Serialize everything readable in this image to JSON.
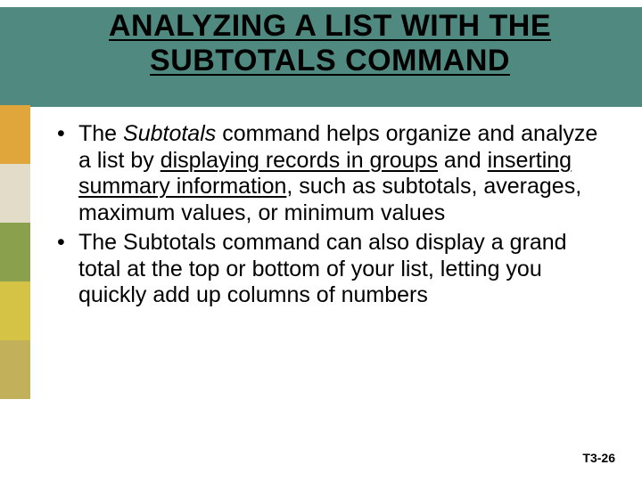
{
  "title": {
    "text": "ANALYZING A LIST WITH THE SUBTOTALS COMMAND"
  },
  "sidebar": {
    "colors": [
      "#e0a63c",
      "#e2dcc8",
      "#8aa04c",
      "#d5c345",
      "#c3b05b"
    ]
  },
  "bullets": [
    {
      "segments": [
        {
          "t": "The "
        },
        {
          "t": "Subtotals",
          "cls": "i"
        },
        {
          "t": " command helps organize and analyze a list by "
        },
        {
          "t": "displaying records in groups",
          "cls": "u"
        },
        {
          "t": " and "
        },
        {
          "t": "inserting summary information",
          "cls": "u"
        },
        {
          "t": ", such as subtotals, averages, maximum values, or minimum values"
        }
      ]
    },
    {
      "segments": [
        {
          "t": "The Subtotals command can also display a grand total at the top or bottom of your list, letting you quickly add up columns of numbers"
        }
      ]
    }
  ],
  "page": "T3-26"
}
